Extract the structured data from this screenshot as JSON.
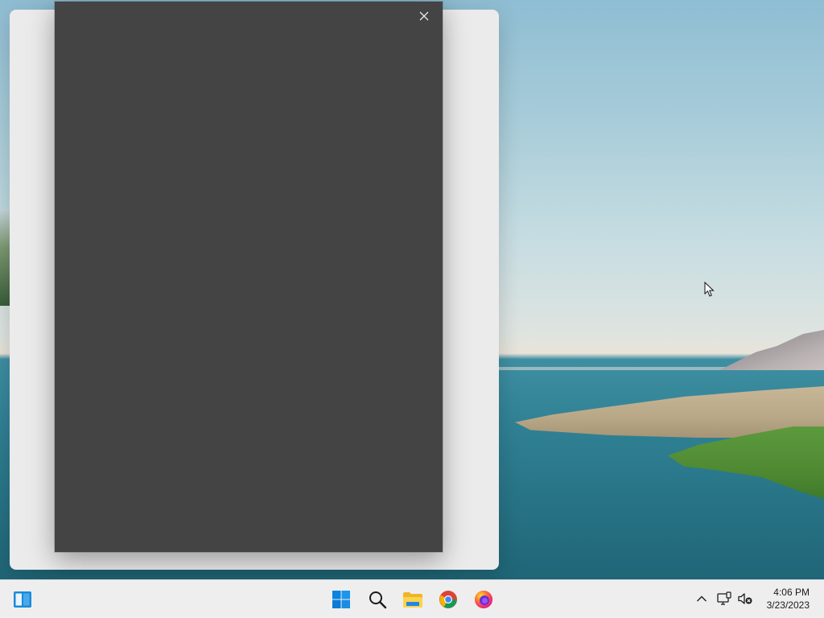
{
  "taskbar": {
    "clock": {
      "time": "4:06 PM",
      "date": "3/23/2023"
    },
    "icons": {
      "widgets": "widgets-icon",
      "start": "windows-start-icon",
      "search": "search-icon",
      "explorer": "file-explorer-icon",
      "chrome": "chrome-icon",
      "firefox": "firefox-icon",
      "overflow": "chevron-up-icon",
      "network": "network-icon",
      "sound": "speaker-muted-icon"
    }
  },
  "dialog": {
    "close_icon": "close-icon"
  },
  "colors": {
    "dialog_bg": "#444444",
    "back_window_bg": "#ebebeb",
    "taskbar_bg": "#eeeeee",
    "start_blue": "#0078d4"
  }
}
